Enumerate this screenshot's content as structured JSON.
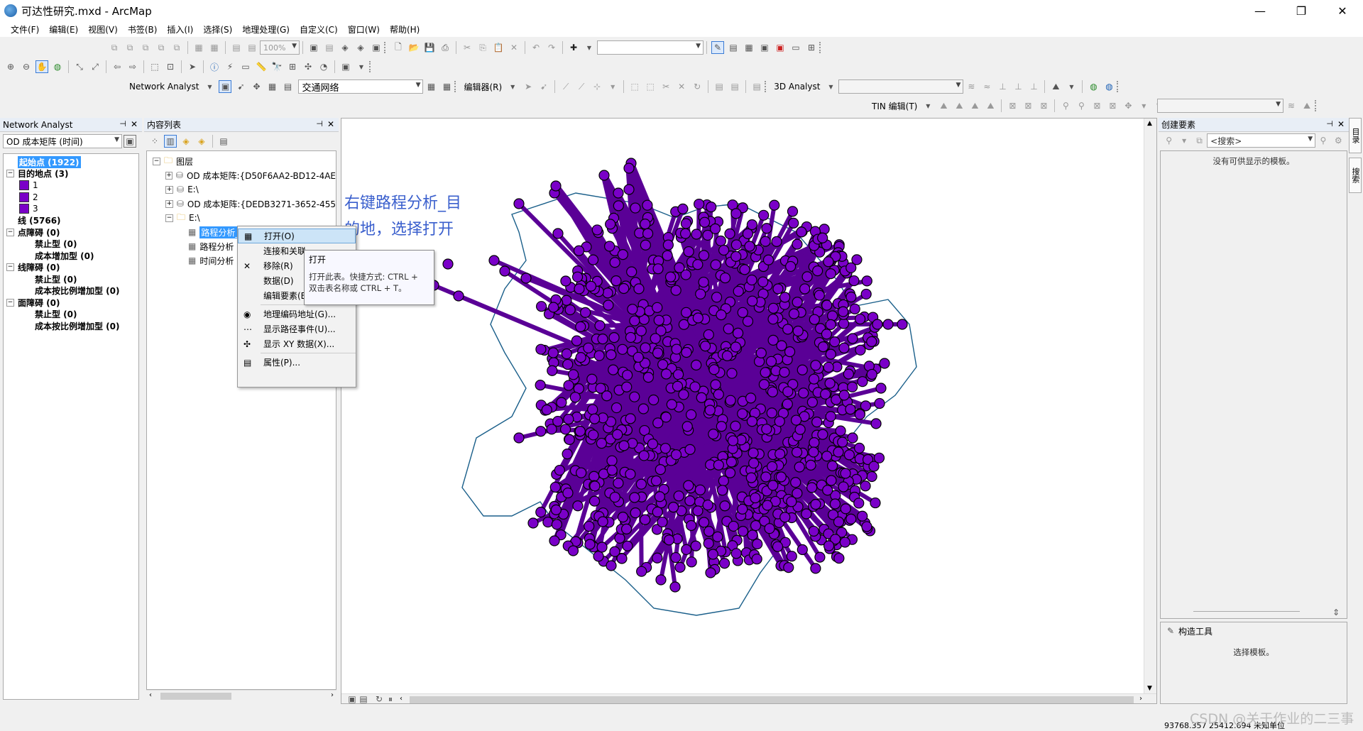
{
  "window": {
    "title": "可达性研究.mxd - ArcMap",
    "minimize": "—",
    "restore": "❐",
    "close": "✕"
  },
  "menu": [
    "文件(F)",
    "编辑(E)",
    "视图(V)",
    "书签(B)",
    "插入(I)",
    "选择(S)",
    "地理处理(G)",
    "自定义(C)",
    "窗口(W)",
    "帮助(H)"
  ],
  "toolbar": {
    "zoom_value": "100%",
    "network_analyst_label": "Network Analyst",
    "network_dataset": "交通网络",
    "editor_label": "编辑器(R)",
    "analyst3d_label": "3D Analyst",
    "tin_label": "TIN 编辑(T)"
  },
  "network_analyst": {
    "title": "Network Analyst",
    "layer_combo": "OD 成本矩阵 (时间)",
    "items": [
      {
        "label": "起始点 (1922)",
        "level": 0,
        "bold": true,
        "selected": true
      },
      {
        "label": "目的地点 (3)",
        "level": 0,
        "bold": true,
        "expander": "−"
      },
      {
        "label": "1",
        "level": 1,
        "swatch": true
      },
      {
        "label": "2",
        "level": 1,
        "swatch": true
      },
      {
        "label": "3",
        "level": 1,
        "swatch": true
      },
      {
        "label": "线 (5766)",
        "level": 0,
        "bold": true
      },
      {
        "label": "点障碍 (0)",
        "level": 0,
        "bold": true,
        "expander": "−"
      },
      {
        "label": "禁止型 (0)",
        "level": 2,
        "bold": true
      },
      {
        "label": "成本增加型 (0)",
        "level": 2,
        "bold": true
      },
      {
        "label": "线障碍 (0)",
        "level": 0,
        "bold": true,
        "expander": "−"
      },
      {
        "label": "禁止型 (0)",
        "level": 2,
        "bold": true
      },
      {
        "label": "成本按比例增加型 (0)",
        "level": 2,
        "bold": true
      },
      {
        "label": "面障碍 (0)",
        "level": 0,
        "bold": true,
        "expander": "−"
      },
      {
        "label": "禁止型 (0)",
        "level": 2,
        "bold": true
      },
      {
        "label": "成本按比例增加型 (0)",
        "level": 2,
        "bold": true
      }
    ]
  },
  "toc": {
    "title": "内容列表",
    "items": [
      {
        "label": "图层",
        "level": 0,
        "expander": "−",
        "icon": "folder"
      },
      {
        "label": "OD 成本矩阵:{D50F6AA2-BD12-4AE",
        "level": 1,
        "expander": "+",
        "icon": "db"
      },
      {
        "label": "E:\\",
        "level": 1,
        "expander": "+",
        "icon": "db"
      },
      {
        "label": "OD 成本矩阵:{DEDB3271-3652-455",
        "level": 1,
        "expander": "+",
        "icon": "db"
      },
      {
        "label": "E:\\",
        "level": 1,
        "expander": "−",
        "icon": "folder"
      },
      {
        "label": "路程分析_目的地",
        "level": 2,
        "icon": "table",
        "selected": true
      },
      {
        "label": "路程分析",
        "level": 2,
        "icon": "table"
      },
      {
        "label": "时间分析",
        "level": 2,
        "icon": "table"
      }
    ]
  },
  "context_menu": {
    "items": [
      {
        "label": "打开(O)",
        "icon": "▦",
        "highlight": true
      },
      {
        "label": "连接和关联",
        "icon": ""
      },
      {
        "label": "移除(R)",
        "icon": "✕"
      },
      {
        "label": "数据(D)",
        "icon": ""
      },
      {
        "label": "编辑要素(E)",
        "icon": "",
        "submenu": true
      },
      {
        "sep": true
      },
      {
        "label": "地理编码地址(G)...",
        "icon": "◉"
      },
      {
        "label": "显示路径事件(U)...",
        "icon": "⋯"
      },
      {
        "label": "显示 XY 数据(X)...",
        "icon": "✣"
      },
      {
        "sep": true
      },
      {
        "label": "属性(P)...",
        "icon": "▤"
      }
    ]
  },
  "tooltip": {
    "title": "打开",
    "line1": "打开此表。快捷方式: CTRL +",
    "line2": "双击表名称或 CTRL + T。"
  },
  "annotation": {
    "line1": "右键路程分析_目",
    "line2": "的地，选择打开"
  },
  "create_features": {
    "title": "创建要素",
    "search_placeholder": "<搜索>",
    "empty_msg": "没有可供显示的模板。",
    "construct_title": "构造工具",
    "construct_msg": "选择模板。"
  },
  "right_tabs": [
    "目录",
    "搜索"
  ],
  "status": {
    "coords": "93768.357  25412.694 未知单位"
  },
  "watermark": "CSDN @关于作业的二三事",
  "colors": {
    "point_fill": "#7a00c8",
    "line": "#5a0096",
    "boundary": "#1a5f8a",
    "annotation": "#3a5fcd"
  }
}
